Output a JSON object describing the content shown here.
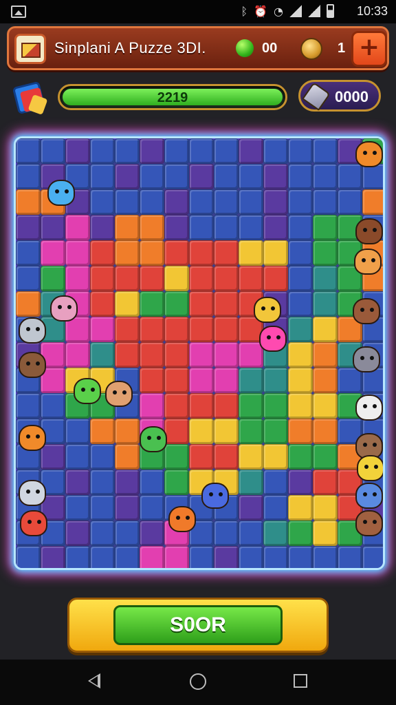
{
  "status_bar": {
    "time": "10:33",
    "icons": [
      "image-icon",
      "bluetooth-icon",
      "alarm-icon",
      "wifi-icon",
      "signal-icon",
      "signal-icon",
      "battery-icon"
    ]
  },
  "header": {
    "title": "Sinplani A Puzze 3DI.",
    "gems": "00",
    "coins": "1",
    "add_label": "+"
  },
  "progress": {
    "label": "2219",
    "value": 1.0
  },
  "hints": {
    "count": "0000"
  },
  "cta": {
    "label": "S0OR"
  },
  "colors": {
    "blue": "#3556b8",
    "purple": "#5a3aa0",
    "teal": "#2f8e8a",
    "green": "#2fa64a",
    "yellow": "#f2c634",
    "orange": "#f07d2a",
    "red": "#e0433a",
    "magenta": "#e23fb0",
    "pink": "#ff5aa0"
  },
  "board": {
    "rows": [
      "BBPBBPBBBPBBBPG",
      "BPBBPBBPBBPBBBB",
      "OOPBBBPBBBPBBBO",
      "PPMPOOPBBBPBGGB",
      "BMMROORRRYYBGGO",
      "BGMRRRYRRRRBTGO",
      "OTMRYGGRRRPBTGB",
      "BTMMRRRRRRPTYOB",
      "PMMTRRRMMMTYOTB",
      "BMYYBRRMMTTYOBB",
      "BBGGBMRRRGGYYGB",
      "BBBOOMRYYGGOOBB",
      "BPBBOGGRRYYGGOB",
      "BBPBPBGYYTBPRRB",
      "BPBBPBBBBPBYYRP",
      "BBPBBPMBBBTGYGB",
      "BPBBBMMBPBBBBBB"
    ]
  },
  "creatures": [
    {
      "name": "orange-cat-creature",
      "color": "#f08a2a"
    },
    {
      "name": "brown-bear-creature",
      "color": "#8a4a2a"
    },
    {
      "name": "orange-fish-creature",
      "color": "#f0a04a"
    },
    {
      "name": "brown-wolf-creature",
      "color": "#9a5a3a"
    },
    {
      "name": "gray-wolf-creature",
      "color": "#8a8a9a"
    },
    {
      "name": "white-cat-creature",
      "color": "#eeeeee"
    },
    {
      "name": "brown-horse-creature",
      "color": "#9a6a4a"
    },
    {
      "name": "yellow-bird-creature",
      "color": "#f2d23a"
    },
    {
      "name": "blue-gift-box-creature",
      "color": "#5a8ae0"
    },
    {
      "name": "brown-monkey-creature",
      "color": "#a06040"
    },
    {
      "name": "gray-shark-creature",
      "color": "#bfc6d0"
    },
    {
      "name": "orange-fox-creature",
      "color": "#f08a2a"
    },
    {
      "name": "white-ghost-creature",
      "color": "#d0d6e0"
    },
    {
      "name": "red-hat-creature",
      "color": "#e84a3a"
    },
    {
      "name": "brown-bug-creature",
      "color": "#8a5a3a"
    },
    {
      "name": "pink-flower-creature",
      "color": "#e8a0c0"
    },
    {
      "name": "green-frog-creature",
      "color": "#5ad04a"
    },
    {
      "name": "pink-bear-creature",
      "color": "#e0a070"
    },
    {
      "name": "green-cat-creature",
      "color": "#4ac050"
    },
    {
      "name": "blue-bird-creature",
      "color": "#4a6ae0"
    },
    {
      "name": "orange-tiger-creature",
      "color": "#f07a2a"
    },
    {
      "name": "yellow-kitten-creature",
      "color": "#f2c63a"
    },
    {
      "name": "pink-worm-creature",
      "color": "#ff4ab0"
    },
    {
      "name": "blue-tower-building",
      "color": "#4ab0f0"
    }
  ]
}
